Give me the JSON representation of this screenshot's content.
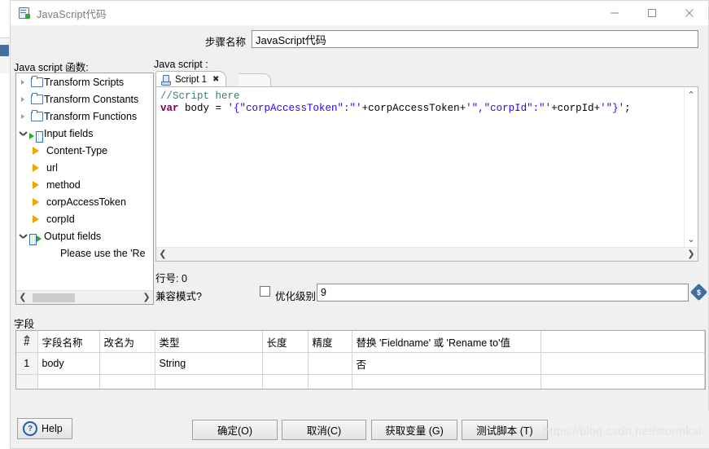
{
  "window": {
    "title": "JavaScript代码",
    "icon": "script-window-icon",
    "controls": {
      "minimize": "minimize-icon",
      "maximize": "maximize-icon",
      "close": "close-icon"
    }
  },
  "step": {
    "label": "步骤名称",
    "value": "JavaScript代码",
    "placeholder": ""
  },
  "labels": {
    "functions_panel": "Java script 函数:",
    "script_panel": "Java script :",
    "line_number": "行号: 0",
    "compat_mode": "兼容模式?",
    "optimization_level": "优化级别",
    "fields_section": "字段"
  },
  "tree": {
    "nodes": [
      {
        "label": "Transform Scripts",
        "icon": "folder-icon",
        "state": "collapsed",
        "indent": 0
      },
      {
        "label": "Transform Constants",
        "icon": "folder-icon",
        "state": "collapsed",
        "indent": 0
      },
      {
        "label": "Transform Functions",
        "icon": "folder-icon",
        "state": "collapsed",
        "indent": 0
      },
      {
        "label": "Input fields",
        "icon": "input-fields-icon",
        "state": "expanded",
        "indent": 0
      },
      {
        "label": "Content-Type",
        "icon": "field-arrow-icon",
        "state": "leaf",
        "indent": 1
      },
      {
        "label": "url",
        "icon": "field-arrow-icon",
        "state": "leaf",
        "indent": 1
      },
      {
        "label": "method",
        "icon": "field-arrow-icon",
        "state": "leaf",
        "indent": 1
      },
      {
        "label": "corpAccessToken",
        "icon": "field-arrow-icon",
        "state": "leaf",
        "indent": 1
      },
      {
        "label": "corpId",
        "icon": "field-arrow-icon",
        "state": "leaf",
        "indent": 1
      },
      {
        "label": "Output fields",
        "icon": "output-fields-icon",
        "state": "expanded",
        "indent": 0
      },
      {
        "label": "Please use the 'Re",
        "icon": "none",
        "state": "text",
        "indent": 2
      }
    ]
  },
  "editor": {
    "tab": {
      "label": "Script 1",
      "icon": "script-tab-icon",
      "close": "close-icon"
    },
    "code": {
      "line1_comment": "//Script here",
      "line2_keyword": "var",
      "line2_rest_a": " body = ",
      "line2_str_a": "'{\"corpAccessToken\":\"'",
      "line2_rest_b": "+corpAccessToken+",
      "line2_str_b": "'\",\"corpId\":\"'",
      "line2_rest_c": "+corpId+",
      "line2_str_c": "'\"}'",
      "line2_rest_d": ";",
      "full": "//Script here\nvar body = '{\"corpAccessToken\":\"'+corpAccessToken+'\",\"corpId\":\"'+corpId+'\"}';"
    },
    "scroll_up": "scroll-up-arrow",
    "scroll_down": "scroll-down-arrow",
    "scroll_left": "scroll-left-arrow",
    "scroll_right": "scroll-right-arrow"
  },
  "optimization": {
    "checkbox_checked": false,
    "value": "9",
    "variable_icon": "insert-variable-icon"
  },
  "fields_table": {
    "columns": [
      "#",
      "字段名称",
      "改名为",
      "类型",
      "长度",
      "精度",
      "替换 'Fieldname' 或 'Rename to'值",
      ""
    ],
    "rows": [
      [
        "1",
        "body",
        "",
        "String",
        "",
        "",
        "否",
        ""
      ],
      [
        "",
        "",
        "",
        "",
        "",
        "",
        "",
        ""
      ]
    ]
  },
  "buttons": {
    "help": "Help",
    "ok": "确定(O)",
    "cancel": "取消(C)",
    "get_variables": "获取变量 (G)",
    "test_script": "测试脚本 (T)"
  },
  "watermark": "https://blog.csdn.net/stormkai",
  "colors": {
    "accent": "#3c6e9f",
    "keyword": "#7f0055",
    "string": "#2a00ff",
    "comment": "#3f7f5f",
    "folder": "#4a7ab0",
    "leaf_arrow": "#f0a500"
  }
}
